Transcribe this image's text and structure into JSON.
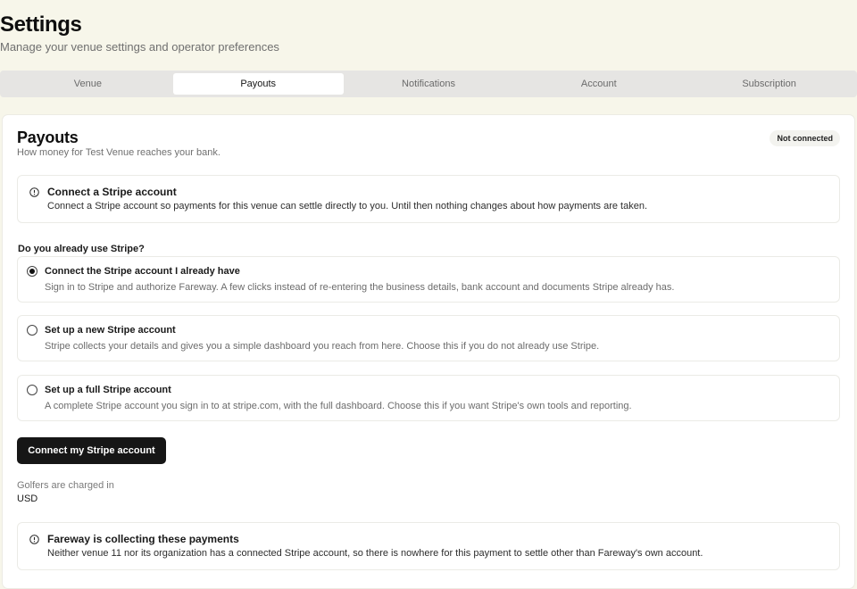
{
  "header": {
    "title": "Settings",
    "subtitle": "Manage your venue settings and operator preferences"
  },
  "tabs": [
    {
      "label": "Venue",
      "active": false
    },
    {
      "label": "Payouts",
      "active": true
    },
    {
      "label": "Notifications",
      "active": false
    },
    {
      "label": "Account",
      "active": false
    },
    {
      "label": "Subscription",
      "active": false
    }
  ],
  "payouts": {
    "title": "Payouts",
    "subtitle": "How money for Test Venue reaches your bank.",
    "status_badge": "Not connected",
    "connect_notice": {
      "icon": "info-icon",
      "title": "Connect a Stripe account",
      "text": "Connect a Stripe account so payments for this venue can settle directly to you. Until then nothing changes about how payments are taken."
    },
    "question": "Do you already use Stripe?",
    "options": [
      {
        "title": "Connect the Stripe account I already have",
        "description": "Sign in to Stripe and authorize Fareway. A few clicks instead of re-entering the business details, bank account and documents Stripe already has.",
        "selected": true
      },
      {
        "title": "Set up a new Stripe account",
        "description": "Stripe collects your details and gives you a simple dashboard you reach from here. Choose this if you do not already use Stripe.",
        "selected": false
      },
      {
        "title": "Set up a full Stripe account",
        "description": "A complete Stripe account you sign in to at stripe.com, with the full dashboard. Choose this if you want Stripe's own tools and reporting.",
        "selected": false
      }
    ],
    "connect_button": "Connect my Stripe account",
    "currency_label": "Golfers are charged in",
    "currency_value": "USD",
    "collecting_notice": {
      "icon": "info-icon",
      "title": "Fareway is collecting these payments",
      "text": "Neither venue 11 nor its organization has a connected Stripe account, so there is nowhere for this payment to settle other than Fareway's own account."
    }
  }
}
